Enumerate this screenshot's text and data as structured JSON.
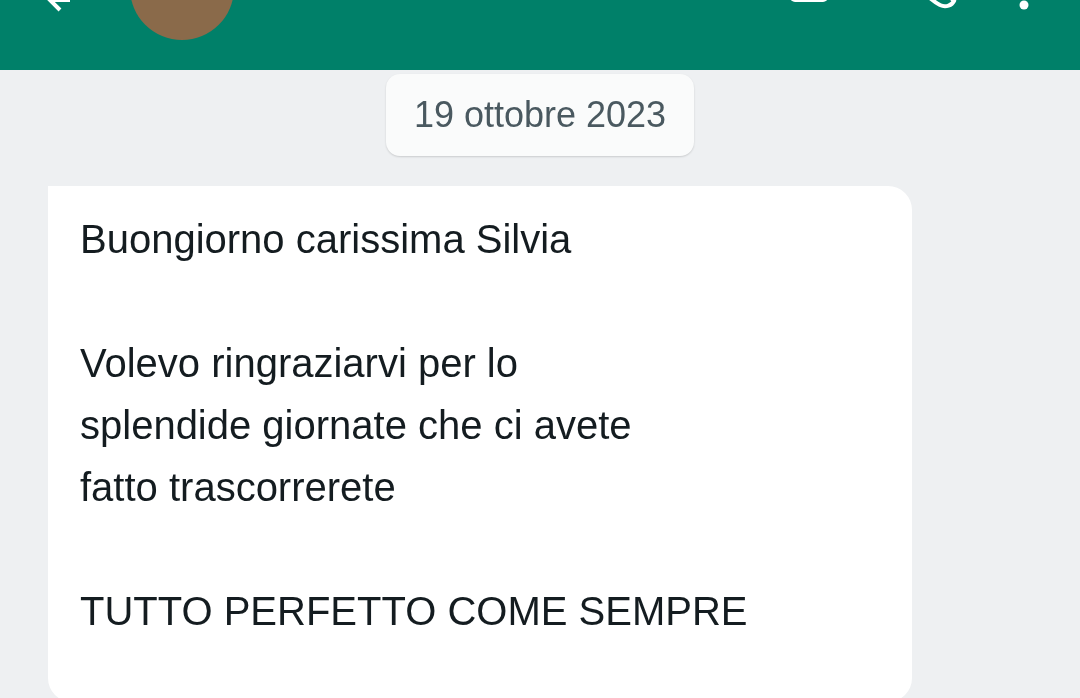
{
  "date_chip": "19 ottobre 2023",
  "messages": [
    {
      "kind": "incoming",
      "paragraphs": [
        [
          "Buongiorno carissima Silvia"
        ],
        [
          "Volevo ringraziarvi per lo",
          "splendide giornate che ci avete",
          "fatto trascorrerete"
        ],
        [
          "TUTTO PERFETTO COME SEMPRE"
        ]
      ]
    }
  ]
}
